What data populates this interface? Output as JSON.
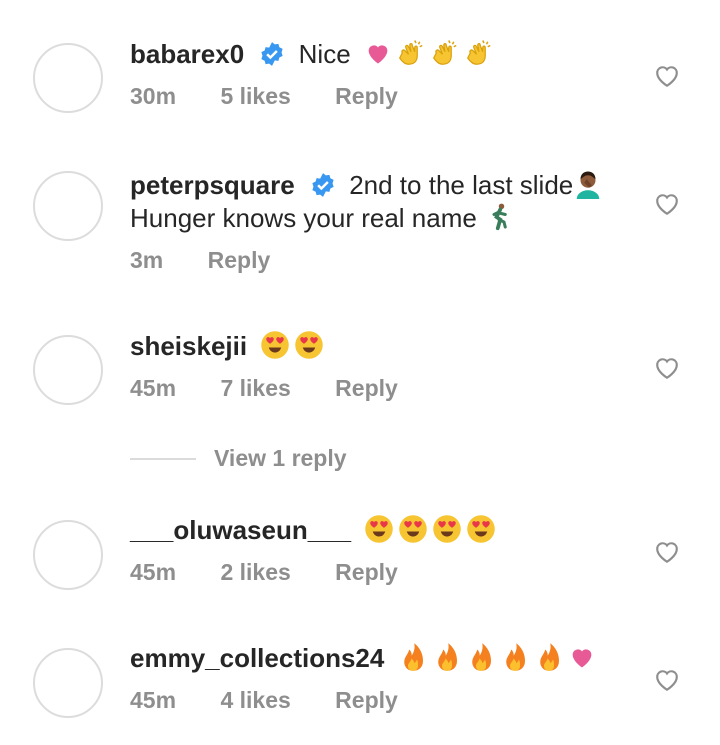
{
  "comments": [
    {
      "username": "babarex0",
      "verified": true,
      "text": "Nice",
      "emoji": [
        "pink-heart",
        "clap",
        "clap",
        "clap"
      ],
      "time": "30m",
      "likes": "5 likes",
      "reply": "Reply"
    },
    {
      "username": "peterpsquare",
      "verified": true,
      "text": "2nd to the last slide",
      "text2": "Hunger knows your real name",
      "emoji": [
        "facepalm",
        "runner"
      ],
      "time": "3m",
      "likes": "",
      "reply": "Reply"
    },
    {
      "username": "sheiskejii",
      "verified": false,
      "text": "",
      "emoji": [
        "heart-eyes",
        "heart-eyes"
      ],
      "time": "45m",
      "likes": "7 likes",
      "reply": "Reply"
    },
    {
      "username": "___oluwaseun___",
      "verified": false,
      "text": "",
      "emoji": [
        "heart-eyes",
        "heart-eyes",
        "heart-eyes",
        "heart-eyes"
      ],
      "time": "45m",
      "likes": "2 likes",
      "reply": "Reply"
    },
    {
      "username": "emmy_collections24",
      "verified": false,
      "text": "",
      "emoji": [
        "fire",
        "fire",
        "fire",
        "fire",
        "fire",
        "pink-heart"
      ],
      "time": "45m",
      "likes": "4 likes",
      "reply": "Reply"
    }
  ],
  "view_replies": "View 1 reply",
  "colors": {
    "verified": "#3897f0",
    "muted": "#8e8e8e",
    "text": "#262626",
    "pink": "#e75a96"
  }
}
